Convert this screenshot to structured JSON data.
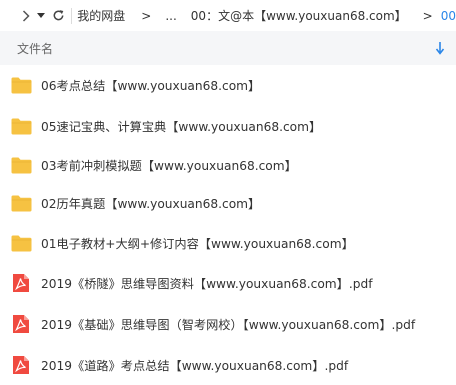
{
  "colors": {
    "folder": "#f6c242",
    "pdf": "#f04a40",
    "accent": "#2a86e8",
    "header_bg": "#f5f6f8"
  },
  "toolbar": {
    "breadcrumb_root": "我的网盘",
    "separator": ">",
    "ellipsis": "...",
    "current_folder": "00：文@本【www.youxuan68.com】",
    "next_separator": ">",
    "overflow_text": "00"
  },
  "header": {
    "column_name": "文件名",
    "sort_icon": "arrow-down-icon"
  },
  "files": [
    {
      "type": "folder",
      "icon": "folder-icon",
      "name": "06考点总结【www.youxuan68.com】"
    },
    {
      "type": "folder",
      "icon": "folder-icon",
      "name": "05速记宝典、计算宝典【www.youxuan68.com】"
    },
    {
      "type": "folder",
      "icon": "folder-icon",
      "name": "03考前冲刺模拟题【www.youxuan68.com】"
    },
    {
      "type": "folder",
      "icon": "folder-icon",
      "name": "02历年真题【www.youxuan68.com】"
    },
    {
      "type": "folder",
      "icon": "folder-icon",
      "name": "01电子教材+大纲+修订内容【www.youxuan68.com】"
    },
    {
      "type": "pdf",
      "icon": "pdf-icon",
      "name": "2019《桥隧》思维导图资料【www.youxuan68.com】.pdf"
    },
    {
      "type": "pdf",
      "icon": "pdf-icon",
      "name": "2019《基础》思维导图（智考网校）【www.youxuan68.com】.pdf"
    },
    {
      "type": "pdf",
      "icon": "pdf-icon",
      "name": "2019《道路》考点总结【www.youxuan68.com】.pdf"
    }
  ]
}
